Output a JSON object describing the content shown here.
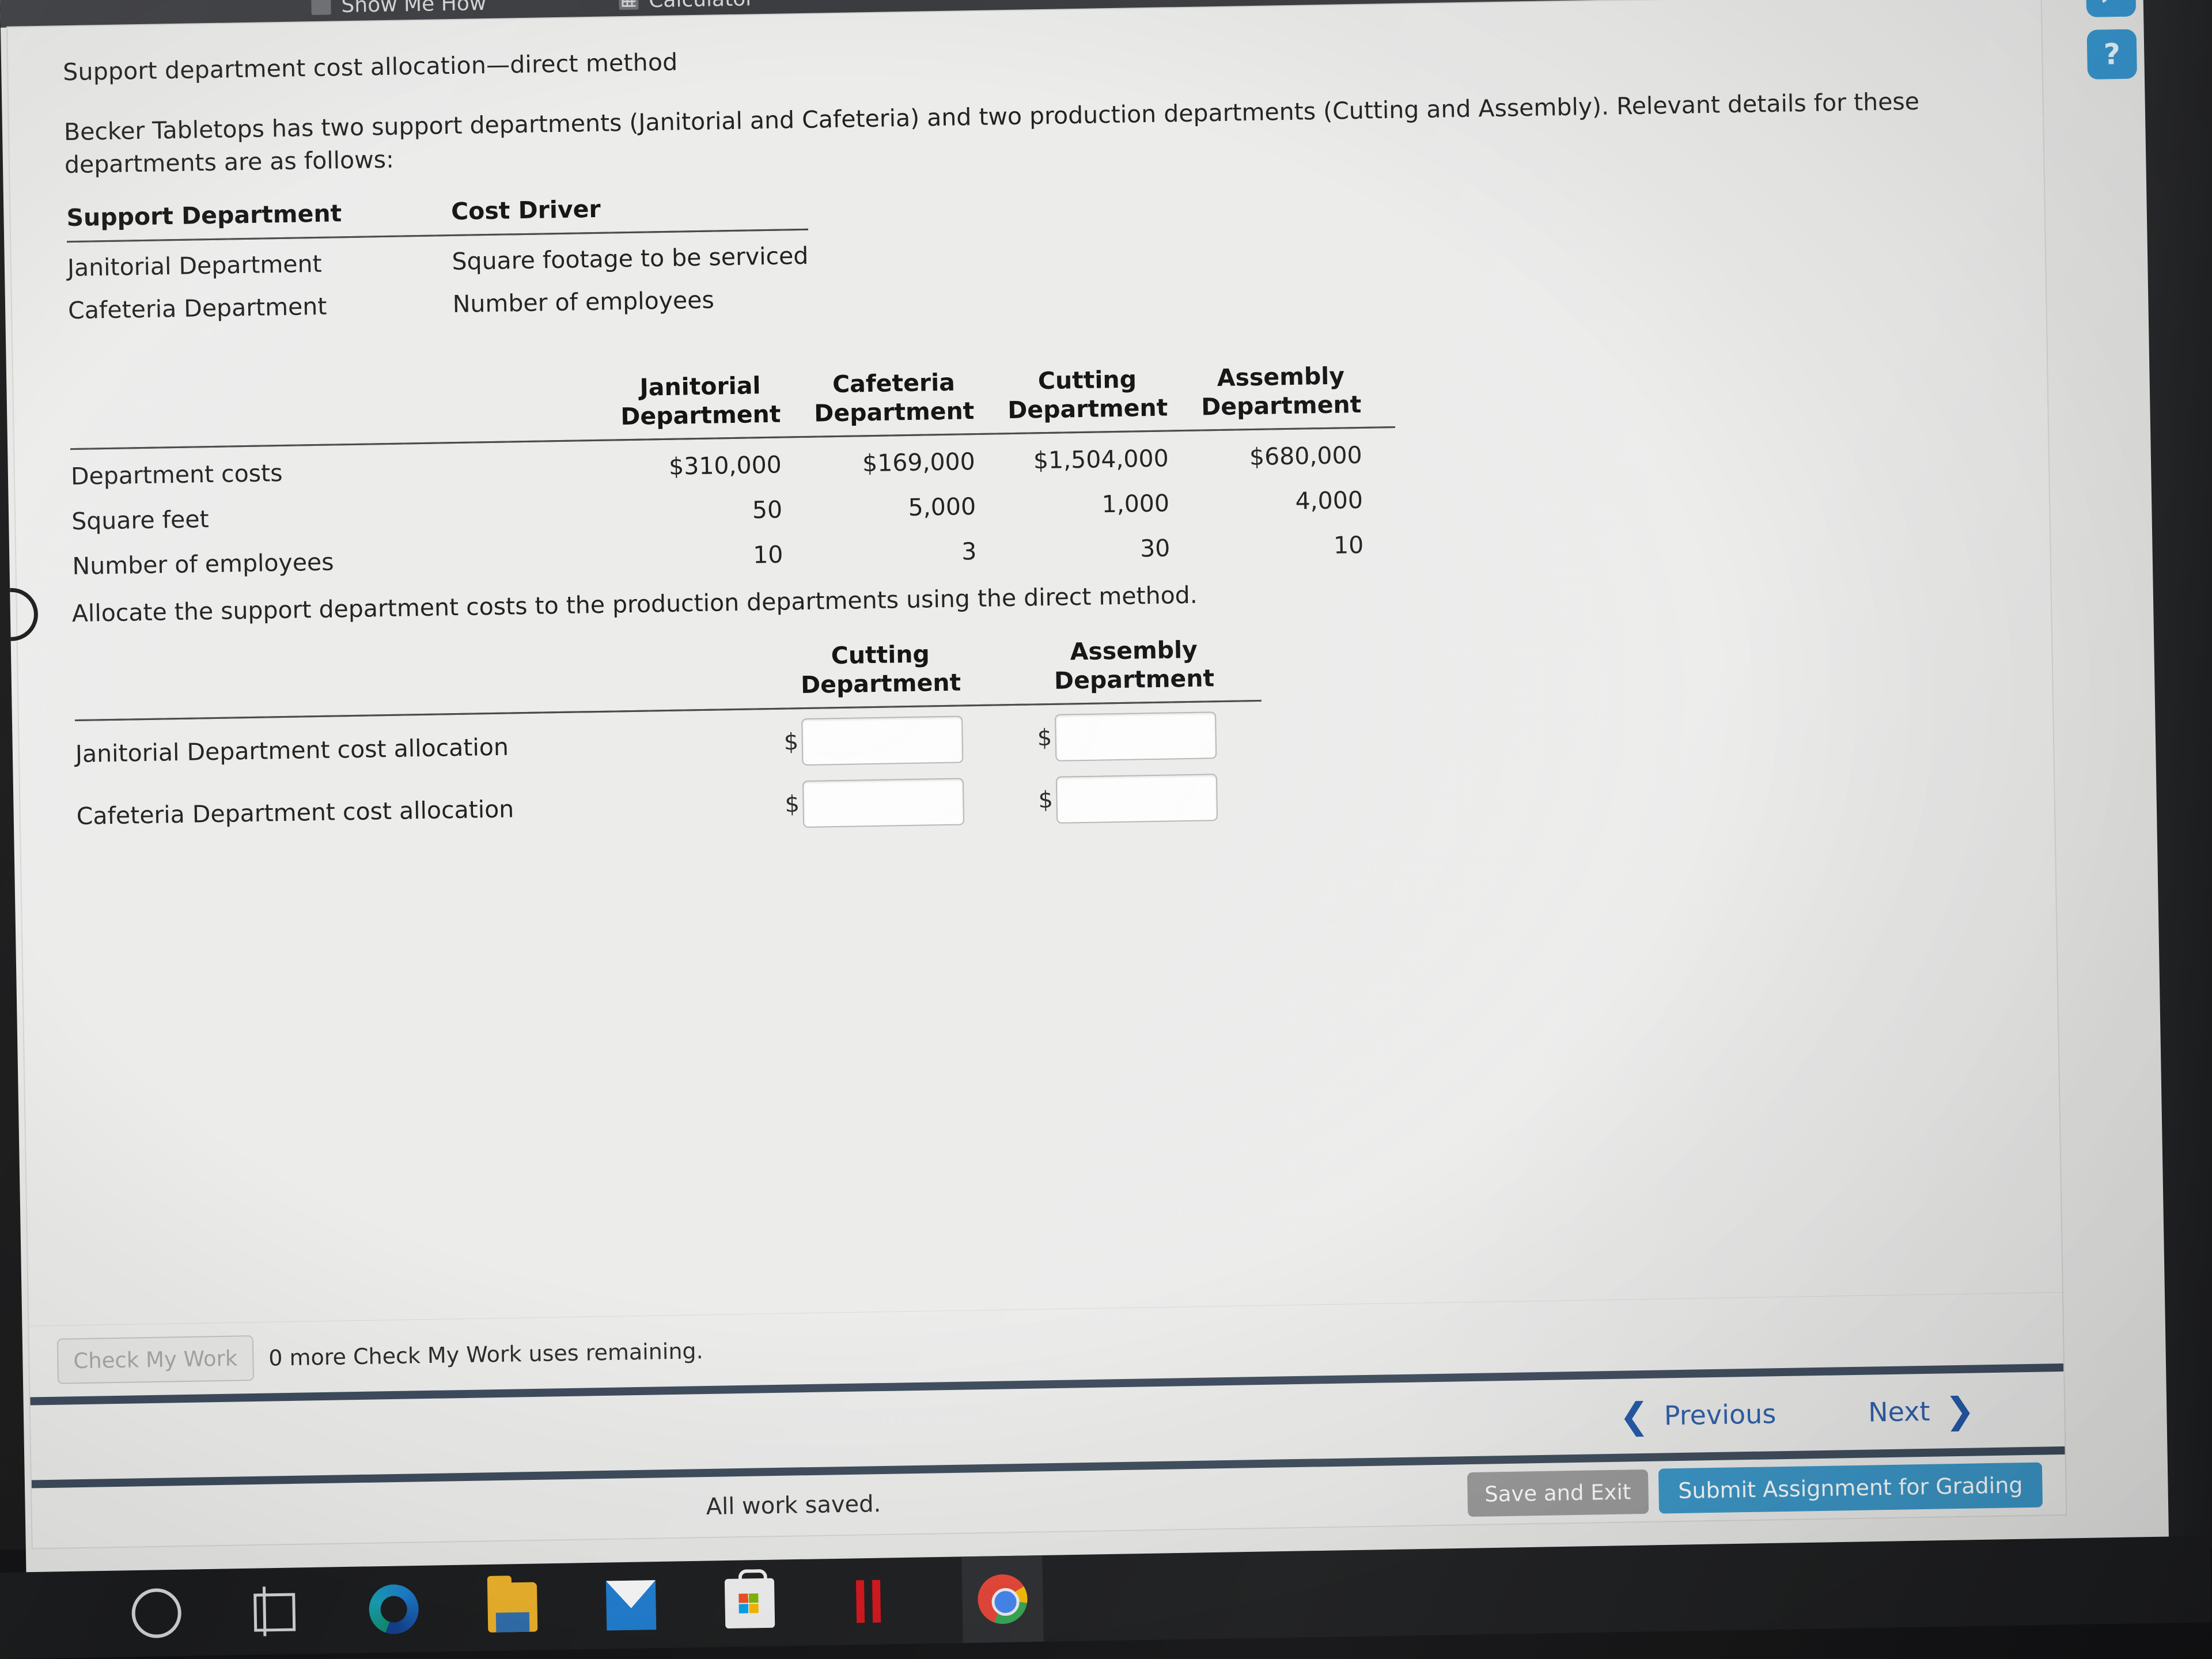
{
  "toolbar": {
    "show_me_how": "Show Me How",
    "calculator": "Calculator"
  },
  "question": {
    "title": "Support department cost allocation—direct method",
    "intro": "Becker Tabletops has two support departments (Janitorial and Cafeteria) and two production departments (Cutting and Assembly). Relevant details for these departments are as follows:",
    "instruction": "Allocate the support department costs to the production departments using the direct method."
  },
  "driver_table": {
    "headers": [
      "Support Department",
      "Cost Driver"
    ],
    "rows": [
      [
        "Janitorial Department",
        "Square footage to be serviced"
      ],
      [
        "Cafeteria Department",
        "Number of employees"
      ]
    ]
  },
  "data_table": {
    "column_headers": [
      "Janitorial\nDepartment",
      "Cafeteria\nDepartment",
      "Cutting\nDepartment",
      "Assembly\nDepartment"
    ],
    "col1_line1": "Janitorial",
    "col1_line2": "Department",
    "col2_line1": "Cafeteria",
    "col2_line2": "Department",
    "col3_line1": "Cutting",
    "col3_line2": "Department",
    "col4_line1": "Assembly",
    "col4_line2": "Department",
    "rows": [
      {
        "label": "Department costs",
        "values": [
          "$310,000",
          "$169,000",
          "$1,504,000",
          "$680,000"
        ]
      },
      {
        "label": "Square feet",
        "values": [
          "50",
          "5,000",
          "1,000",
          "4,000"
        ]
      },
      {
        "label": "Number of employees",
        "values": [
          "10",
          "3",
          "30",
          "10"
        ]
      }
    ]
  },
  "answer_table": {
    "col1_line1": "Cutting",
    "col1_line2": "Department",
    "col2_line1": "Assembly",
    "col2_line2": "Department",
    "rows": [
      {
        "label": "Janitorial Department cost allocation",
        "cutting": "",
        "assembly": ""
      },
      {
        "label": "Cafeteria Department cost allocation",
        "cutting": "",
        "assembly": ""
      }
    ],
    "currency_symbol": "$"
  },
  "check_my_work": {
    "button_label": "Check My Work",
    "uses_text": "0 more Check My Work uses remaining."
  },
  "navigation": {
    "previous": "Previous",
    "next": "Next",
    "prev_chevron": "❮",
    "next_chevron": "❯"
  },
  "footer": {
    "saved_status": "All work saved.",
    "save_and_exit": "Save and Exit",
    "submit": "Submit Assignment for Grading"
  },
  "help_rail": {
    "chat_icon_glyph": "💬",
    "question_icon_glyph": "?"
  },
  "colors": {
    "accent_blue": "#3896c8",
    "link_blue": "#2b5ea8",
    "rule_dark": "#3d4a5c",
    "grey_button": "#9a9a9a"
  }
}
